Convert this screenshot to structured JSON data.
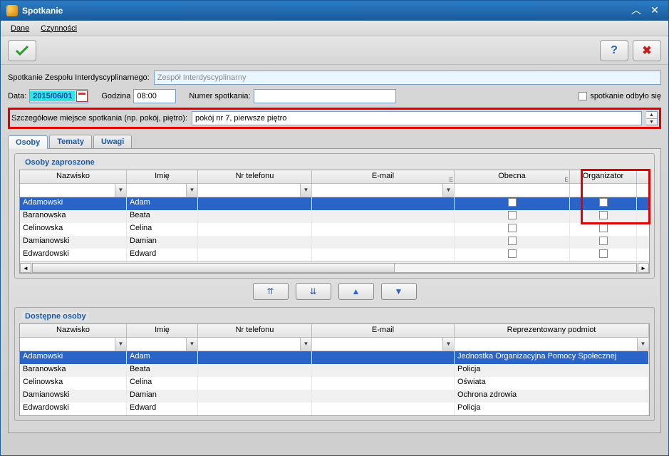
{
  "window": {
    "title": "Spotkanie"
  },
  "menu": {
    "dane": "Dane",
    "czynnosci": "Czynności"
  },
  "toolbar": {
    "ok": "ok",
    "help": "?",
    "close": "X"
  },
  "form": {
    "team_label": "Spotkanie Zespołu Interdyscyplinarnego:",
    "team_value": "Zespół Interdyscyplinarny",
    "date_label": "Data:",
    "date_value": "2015/06/01",
    "time_label": "Godzina",
    "time_value": "08:00",
    "num_label": "Numer spotkania:",
    "num_value": "",
    "held_label": "spotkanie odbyło się",
    "loc_label": "Szczegółowe miejsce spotkania (np. pokój, piętro):",
    "loc_value": "pokój nr 7, pierwsze piętro"
  },
  "tabs": {
    "osoby": "Osoby",
    "tematy": "Tematy",
    "uwagi": "Uwagi"
  },
  "groups": {
    "invited": "Osoby zaproszone",
    "available": "Dostępne osoby"
  },
  "invited": {
    "headers": {
      "nazwisko": "Nazwisko",
      "imie": "Imię",
      "tel": "Nr telefonu",
      "email": "E-mail",
      "obecna": "Obecna",
      "org": "Organizator"
    },
    "rows": [
      {
        "nazwisko": "Adamowski",
        "imie": "Adam",
        "tel": "",
        "email": "",
        "obecna": false,
        "org": true,
        "selected": true
      },
      {
        "nazwisko": "Baranowska",
        "imie": "Beata",
        "tel": "",
        "email": "",
        "obecna": false,
        "org": false
      },
      {
        "nazwisko": "Celinowska",
        "imie": "Celina",
        "tel": "",
        "email": "",
        "obecna": false,
        "org": false
      },
      {
        "nazwisko": "Damianowski",
        "imie": "Damian",
        "tel": "",
        "email": "",
        "obecna": false,
        "org": false
      },
      {
        "nazwisko": "Edwardowski",
        "imie": "Edward",
        "tel": "",
        "email": "",
        "obecna": false,
        "org": false
      }
    ]
  },
  "available": {
    "headers": {
      "nazwisko": "Nazwisko",
      "imie": "Imię",
      "tel": "Nr telefonu",
      "email": "E-mail",
      "rep": "Reprezentowany podmiot"
    },
    "rows": [
      {
        "nazwisko": "Adamowski",
        "imie": "Adam",
        "tel": "",
        "email": "",
        "rep": "Jednostka Organizacyjna Pomocy Społecznej",
        "selected": true
      },
      {
        "nazwisko": "Baranowska",
        "imie": "Beata",
        "tel": "",
        "email": "",
        "rep": "Policja"
      },
      {
        "nazwisko": "Celinowska",
        "imie": "Celina",
        "tel": "",
        "email": "",
        "rep": "Oświata"
      },
      {
        "nazwisko": "Damianowski",
        "imie": "Damian",
        "tel": "",
        "email": "",
        "rep": "Ochrona zdrowia"
      },
      {
        "nazwisko": "Edwardowski",
        "imie": "Edward",
        "tel": "",
        "email": "",
        "rep": "Policja"
      }
    ]
  }
}
